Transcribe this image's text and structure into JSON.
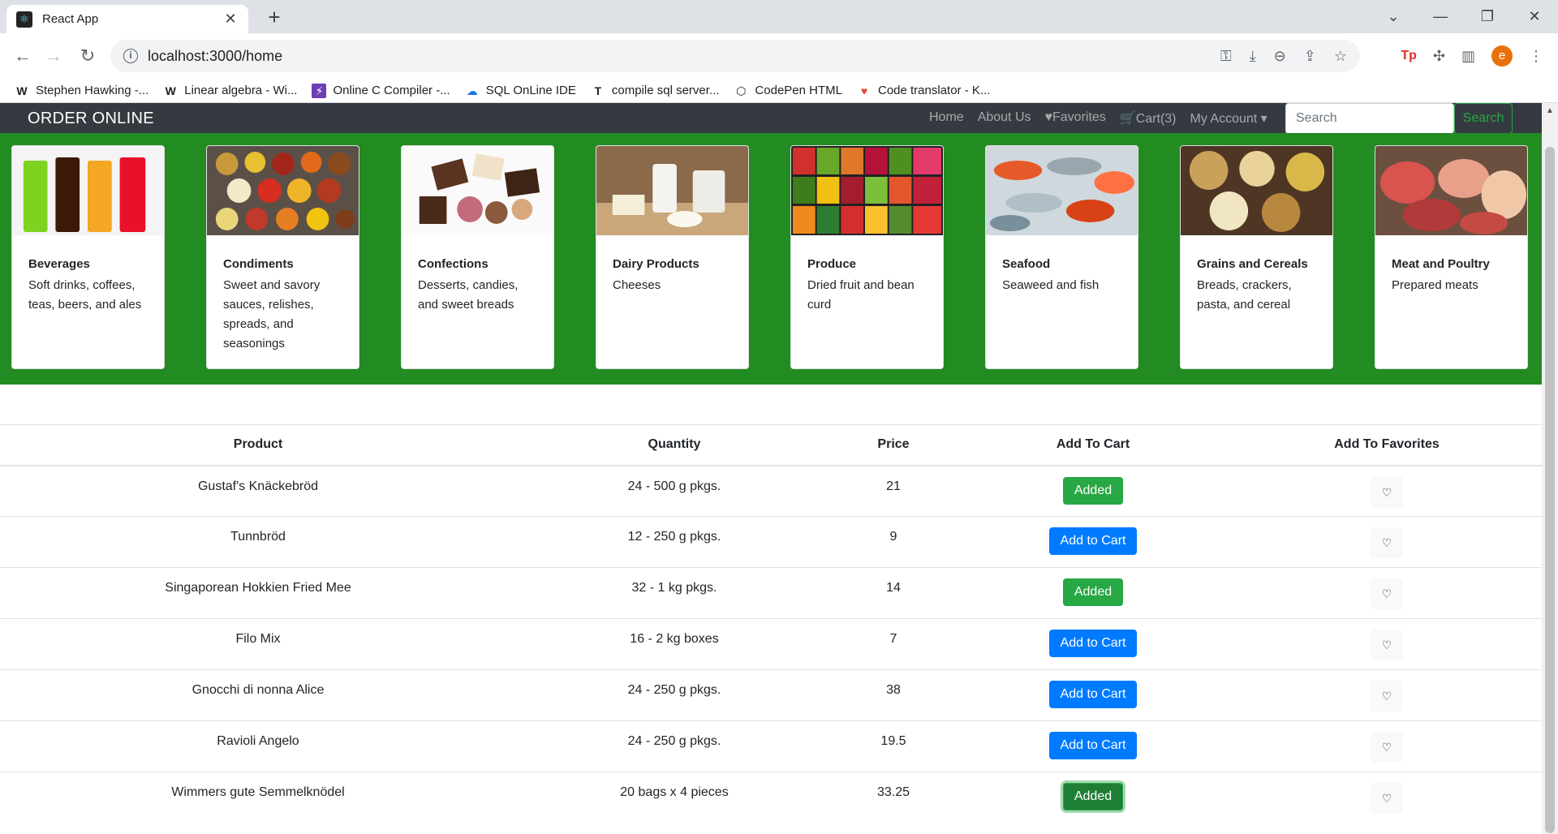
{
  "browser": {
    "tab_title": "React App",
    "tab_close": "✕",
    "new_tab": "+",
    "url": "localhost:3000/home",
    "profile_initial": "e",
    "ext_tp": "Tp",
    "bookmarks": [
      {
        "icon": "W",
        "label": "Stephen Hawking -..."
      },
      {
        "icon": "W",
        "label": "Linear algebra - Wi..."
      },
      {
        "icon": "⚡",
        "label": "Online C Compiler -..."
      },
      {
        "icon": "☁",
        "label": "SQL OnLine IDE"
      },
      {
        "icon": "T",
        "label": "compile sql server..."
      },
      {
        "icon": "⬡",
        "label": "CodePen HTML"
      },
      {
        "icon": "♥",
        "label": "Code translator - K..."
      }
    ]
  },
  "navbar": {
    "brand": "ORDER ONLINE",
    "links": [
      "Home",
      "About Us",
      "♥Favorites",
      "🛒Cart(3)",
      "My Account ▾"
    ],
    "search_placeholder": "Search",
    "search_button": "Search"
  },
  "categories": [
    {
      "name": "Beverages",
      "description": "Soft drinks, coffees, teas, beers, and ales",
      "image": "beverages-image"
    },
    {
      "name": "Condiments",
      "description": "Sweet and savory sauces, relishes, spreads, and seasonings",
      "image": "condiments-image"
    },
    {
      "name": "Confections",
      "description": "Desserts, candies, and sweet breads",
      "image": "confections-image"
    },
    {
      "name": "Dairy Products",
      "description": "Cheeses",
      "image": "dairy-image"
    },
    {
      "name": "Produce",
      "description": "Dried fruit and bean curd",
      "image": "produce-image"
    },
    {
      "name": "Seafood",
      "description": "Seaweed and fish",
      "image": "seafood-image"
    },
    {
      "name": "Grains and Cereals",
      "description": "Breads, crackers, pasta, and cereal",
      "image": "grains-image"
    },
    {
      "name": "Meat and Poultry",
      "description": "Prepared meats",
      "image": "meat-image"
    }
  ],
  "table": {
    "headers": [
      "Product",
      "Quantity",
      "Price",
      "Add To Cart",
      "Add To Favorites"
    ],
    "rows": [
      {
        "product": "Gustaf's Knäckebröd",
        "quantity": "24 - 500 g pkgs.",
        "price": "21",
        "cart_label": "Added",
        "added": true
      },
      {
        "product": "Tunnbröd",
        "quantity": "12 - 250 g pkgs.",
        "price": "9",
        "cart_label": "Add to Cart",
        "added": false
      },
      {
        "product": "Singaporean Hokkien Fried Mee",
        "quantity": "32 - 1 kg pkgs.",
        "price": "14",
        "cart_label": "Added",
        "added": true
      },
      {
        "product": "Filo Mix",
        "quantity": "16 - 2 kg boxes",
        "price": "7",
        "cart_label": "Add to Cart",
        "added": false
      },
      {
        "product": "Gnocchi di nonna Alice",
        "quantity": "24 - 250 g pkgs.",
        "price": "38",
        "cart_label": "Add to Cart",
        "added": false
      },
      {
        "product": "Ravioli Angelo",
        "quantity": "24 - 250 g pkgs.",
        "price": "19.5",
        "cart_label": "Add to Cart",
        "added": false
      },
      {
        "product": "Wimmers gute Semmelknödel",
        "quantity": "20 bags x 4 pieces",
        "price": "33.25",
        "cart_label": "Added",
        "added": true
      }
    ],
    "fav_icon": "♡"
  },
  "colors": {
    "hero": "#228b22",
    "navbar": "#343a40",
    "primary": "#007bff",
    "success": "#28a745"
  }
}
